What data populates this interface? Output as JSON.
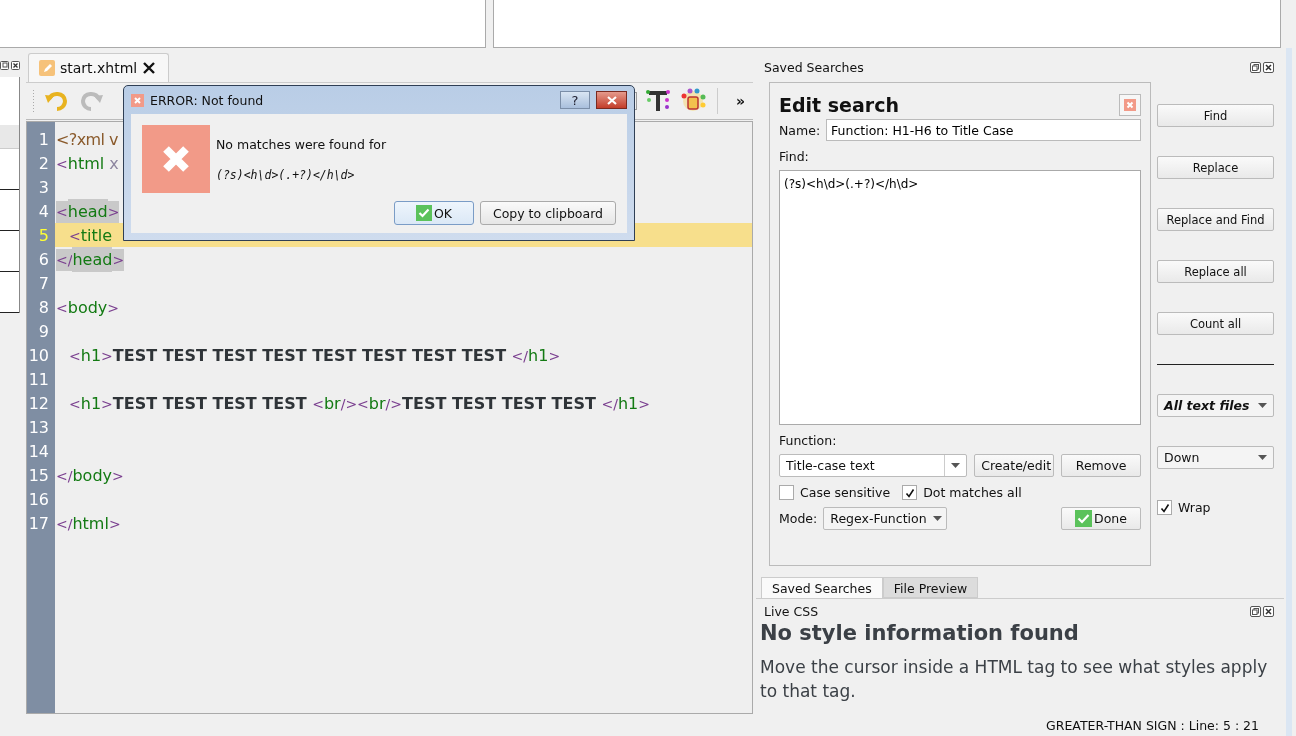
{
  "editor": {
    "tab": {
      "label": "start.xhtml",
      "selected": true
    },
    "toolbar": {
      "overflow": "»"
    },
    "lines": [
      {
        "number": "1",
        "current": false,
        "tokens": [
          {
            "t": "<?xml v",
            "kind": "pi",
            "match": false
          }
        ]
      },
      {
        "number": "2",
        "current": false,
        "tokens": [
          {
            "t": "<",
            "kind": "punct",
            "match": false
          },
          {
            "t": "html",
            "kind": "tag",
            "match": false
          },
          {
            "t": " x",
            "kind": "attr",
            "match": false
          }
        ]
      },
      {
        "number": "3",
        "current": false
      },
      {
        "number": "4",
        "current": false,
        "tokens": [
          {
            "t": "<",
            "kind": "punct",
            "match": true
          },
          {
            "t": "head",
            "kind": "tag",
            "match": true
          },
          {
            "t": ">",
            "kind": "punct",
            "match": true
          }
        ]
      },
      {
        "number": "5",
        "current": true,
        "indent": true,
        "tokens": [
          {
            "t": "<",
            "kind": "punct",
            "match": false
          },
          {
            "t": "title",
            "kind": "tag",
            "match": false
          }
        ]
      },
      {
        "number": "6",
        "current": false,
        "tokens": [
          {
            "t": "</",
            "kind": "punct",
            "match": true
          },
          {
            "t": "head",
            "kind": "tag",
            "match": true
          },
          {
            "t": ">",
            "kind": "punct",
            "match": true
          }
        ]
      },
      {
        "number": "7",
        "current": false
      },
      {
        "number": "8",
        "current": false,
        "tokens": [
          {
            "t": "<",
            "kind": "punct",
            "match": false
          },
          {
            "t": "body",
            "kind": "tag",
            "match": false
          },
          {
            "t": ">",
            "kind": "punct",
            "match": false
          }
        ]
      },
      {
        "number": "9",
        "current": false
      },
      {
        "number": "10",
        "current": false,
        "indent": true,
        "tokens": [
          {
            "t": "<",
            "kind": "punct",
            "match": false
          },
          {
            "t": "h1",
            "kind": "tag",
            "match": false
          },
          {
            "t": ">",
            "kind": "punct",
            "match": false
          },
          {
            "t": "TEST TEST TEST TEST TEST TEST TEST TEST ",
            "kind": "text",
            "match": false
          },
          {
            "t": "</",
            "kind": "punct",
            "match": false
          },
          {
            "t": "h1",
            "kind": "tag",
            "match": false
          },
          {
            "t": ">",
            "kind": "punct",
            "match": false
          }
        ]
      },
      {
        "number": "11",
        "current": false
      },
      {
        "number": "12",
        "current": false,
        "indent": true,
        "tokens": [
          {
            "t": "<",
            "kind": "punct",
            "match": false
          },
          {
            "t": "h1",
            "kind": "tag",
            "match": false
          },
          {
            "t": ">",
            "kind": "punct",
            "match": false
          },
          {
            "t": "TEST TEST TEST TEST ",
            "kind": "text",
            "match": false
          },
          {
            "t": "<",
            "kind": "punct",
            "match": false
          },
          {
            "t": "br",
            "kind": "tag",
            "match": false
          },
          {
            "t": "/><",
            "kind": "punct",
            "match": false
          },
          {
            "t": "br",
            "kind": "tag",
            "match": false
          },
          {
            "t": "/>",
            "kind": "punct",
            "match": false
          },
          {
            "t": "TEST TEST TEST TEST ",
            "kind": "text",
            "match": false
          },
          {
            "t": "</",
            "kind": "punct",
            "match": false
          },
          {
            "t": "h1",
            "kind": "tag",
            "match": false
          },
          {
            "t": ">",
            "kind": "punct",
            "match": false
          }
        ]
      },
      {
        "number": "13",
        "current": false
      },
      {
        "number": "14",
        "current": false
      },
      {
        "number": "15",
        "current": false,
        "tokens": [
          {
            "t": "</",
            "kind": "punct",
            "match": false
          },
          {
            "t": "body",
            "kind": "tag",
            "match": false
          },
          {
            "t": ">",
            "kind": "punct",
            "match": false
          }
        ]
      },
      {
        "number": "16",
        "current": false
      },
      {
        "number": "17",
        "current": false,
        "tokens": [
          {
            "t": "</",
            "kind": "punct",
            "match": false
          },
          {
            "t": "html",
            "kind": "tag",
            "match": false
          },
          {
            "t": ">",
            "kind": "punct",
            "match": false
          }
        ]
      }
    ]
  },
  "dialog": {
    "title": "ERROR: Not found",
    "help": "?",
    "message": "No matches were found for",
    "pattern": "(?s)<h\\d>(.+?)</h\\d>",
    "buttons": [
      {
        "label": "OK",
        "kind": "ok"
      },
      {
        "label": "Copy to clipboard",
        "kind": "plain"
      }
    ]
  },
  "saved_searches": {
    "title": "Saved Searches",
    "edit_search": {
      "heading": "Edit search",
      "name_label": "Name:",
      "name": "Function: H1-H6 to Title Case",
      "find_label": "Find:",
      "find": "(?s)<h\\d>(.+?)</h\\d>",
      "function_label": "Function:",
      "function": "Title-case text",
      "function_buttons": [
        "Create/edit",
        "Remove"
      ],
      "options": [
        {
          "label": "Case sensitive",
          "checked": false
        },
        {
          "label": "Dot matches all",
          "checked": true
        }
      ],
      "mode_label": "Mode:",
      "mode": "Regex-Function",
      "done": "Done"
    },
    "actions": [
      "Find",
      "Replace",
      "Replace and Find",
      "Replace all",
      "Count all"
    ],
    "file_type": "All text files",
    "direction": "Down",
    "wrap": {
      "label": "Wrap",
      "checked": true
    }
  },
  "dock_tabs": [
    {
      "label": "Saved Searches",
      "selected": true
    },
    {
      "label": "File Preview",
      "selected": false
    }
  ],
  "live_css": {
    "title": "Live CSS",
    "heading": "No style information found",
    "message": "Move the cursor inside a HTML tag to see what styles apply to that tag."
  },
  "status_bar": {
    "text": "GREATER-THAN SIGN : Line: 5 : 21"
  }
}
